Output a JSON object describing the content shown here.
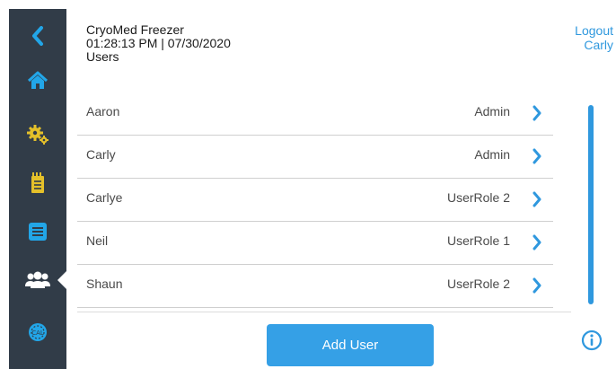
{
  "header": {
    "device_name": "CryoMed Freezer",
    "datetime": "01:28:13 PM | 07/30/2020",
    "page_title": "Users"
  },
  "account": {
    "logout_label": "Logout",
    "user": "Carly"
  },
  "users": [
    {
      "name": "Aaron",
      "role": "Admin"
    },
    {
      "name": "Carly",
      "role": "Admin"
    },
    {
      "name": "Carlye",
      "role": "UserRole 2"
    },
    {
      "name": "Neil",
      "role": "UserRole 1"
    },
    {
      "name": "Shaun",
      "role": "UserRole 2"
    }
  ],
  "actions": {
    "add_user_label": "Add User"
  },
  "sidebar": {
    "items": [
      {
        "icon": "back-chevron-icon"
      },
      {
        "icon": "home-icon"
      },
      {
        "icon": "gears-icon"
      },
      {
        "icon": "notepad-icon"
      },
      {
        "icon": "list-icon"
      },
      {
        "icon": "users-icon",
        "active": true
      },
      {
        "icon": "calibration-icon"
      }
    ]
  },
  "colors": {
    "sidebar_bg": "#313c48",
    "accent": "#2f98de",
    "icon_accent": "#22a6e8",
    "button": "#35a0e6"
  }
}
